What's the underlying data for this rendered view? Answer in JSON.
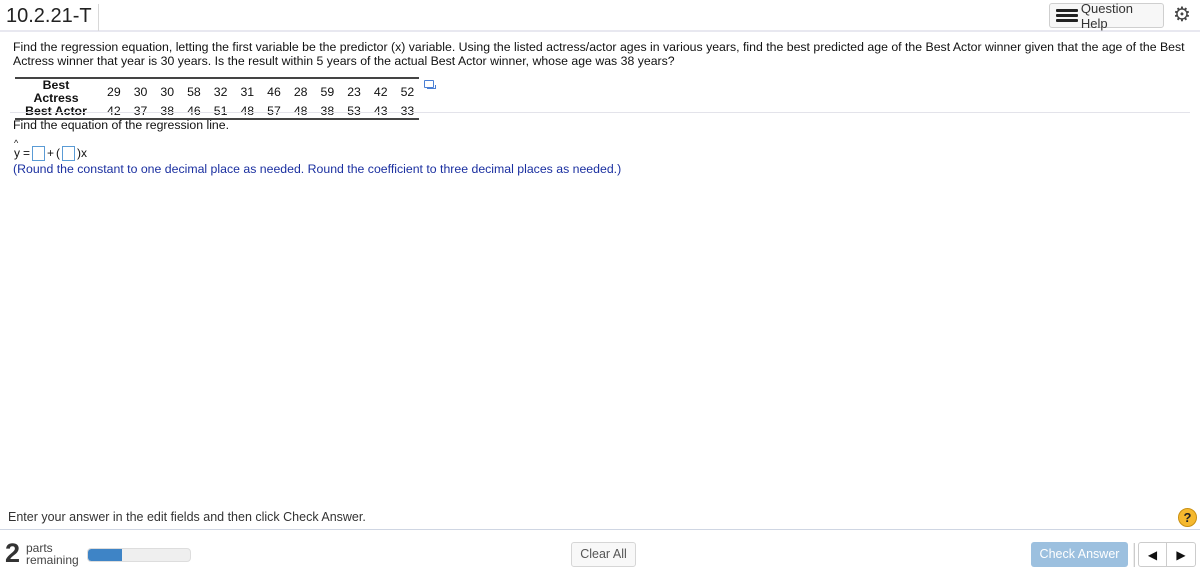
{
  "header": {
    "question_id": "10.2.21-T",
    "help_button_label": "Question Help",
    "settings_icon": "gear-icon"
  },
  "question": {
    "text": "Find the regression equation, letting the first variable be the predictor (x) variable. Using the listed actress/actor ages in various years, find the best predicted age of the Best Actor winner given that the age of the Best Actress winner that year is 30 years. Is the result within 5 years of the actual Best Actor winner, whose age was 38 years?"
  },
  "table": {
    "rows": [
      {
        "label": "Best Actress",
        "values": [
          "29",
          "30",
          "30",
          "58",
          "32",
          "31",
          "46",
          "28",
          "59",
          "23",
          "42",
          "52"
        ]
      },
      {
        "label": "Best Actor",
        "values": [
          "42",
          "37",
          "38",
          "46",
          "51",
          "48",
          "57",
          "48",
          "38",
          "53",
          "43",
          "33"
        ]
      }
    ],
    "copy_icon": "copy-data-icon"
  },
  "part": {
    "prompt": "Find the equation of the regression line.",
    "equation": {
      "lhs": "y",
      "hat": "^",
      "equals": "=",
      "plus": "+",
      "open_paren": "(",
      "close_paren_x": ")x",
      "constant_value": "",
      "coefficient_value": ""
    },
    "hint": "(Round the constant to one decimal place as needed. Round the coefficient to three decimal places as needed.)"
  },
  "footer": {
    "instruction": "Enter your answer in the edit fields and then click Check Answer.",
    "help_symbol": "?",
    "parts_remaining_count": "2",
    "parts_label_1": "parts",
    "parts_label_2": "remaining",
    "progress_fraction": 0.33,
    "clear_all_label": "Clear All",
    "check_answer_label": "Check Answer",
    "prev_symbol": "◀",
    "next_symbol": "▶"
  },
  "colors": {
    "accent_blue": "#3e84c6",
    "check_button_disabled": "#9cc0df",
    "hint_text": "#1a2fa0",
    "help_circle": "#f5b82e"
  }
}
